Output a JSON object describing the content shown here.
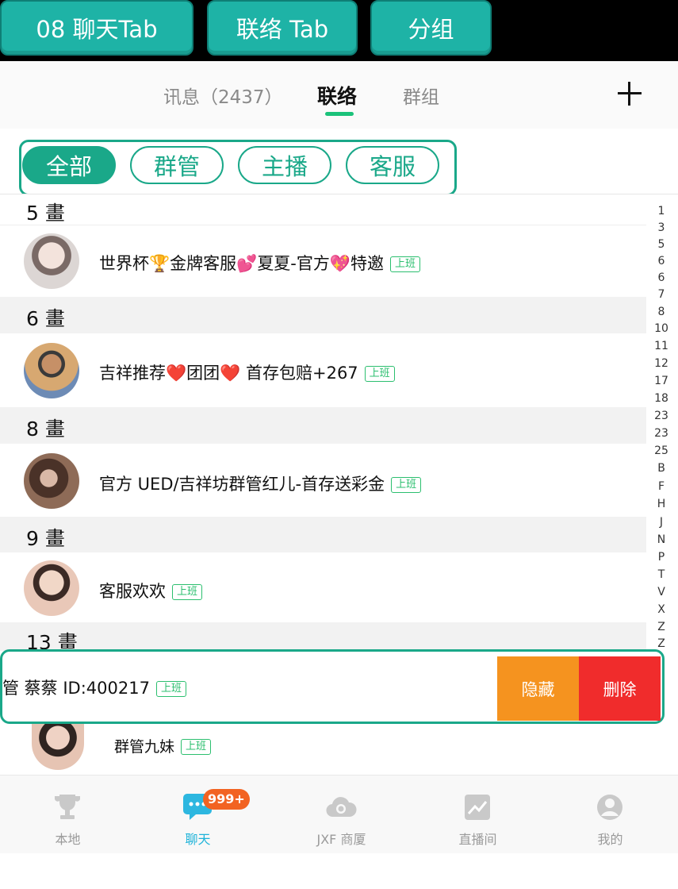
{
  "annotation_tabs": [
    "08 聊天Tab",
    "联络 Tab",
    "分组"
  ],
  "top_tabs": [
    {
      "label": "讯息（2437）",
      "active": false
    },
    {
      "label": "联络",
      "active": true
    },
    {
      "label": "群组",
      "active": false
    }
  ],
  "filters": [
    {
      "label": "全部",
      "active": true
    },
    {
      "label": "群管",
      "active": false
    },
    {
      "label": "主播",
      "active": false
    },
    {
      "label": "客服",
      "active": false
    }
  ],
  "sections": [
    {
      "header": "5 畫",
      "contact": {
        "name": "世界杯",
        "parts": [
          "🏆",
          "金牌客服",
          "💕",
          "夏夏-官方",
          "💖",
          "特邀"
        ],
        "status": "上班"
      }
    },
    {
      "header": "6 畫",
      "contact": {
        "name": "吉祥推荐",
        "parts": [
          "❤️",
          "团团",
          "❤️",
          " 首存包赔+267"
        ],
        "status": "上班"
      }
    },
    {
      "header": "8 畫",
      "contact": {
        "name": "官方 UED/吉祥坊群管红儿-首存送彩金",
        "parts": [],
        "status": "上班"
      }
    },
    {
      "header": "9 畫",
      "contact": {
        "name": "客服欢欢",
        "parts": [],
        "status": "上班"
      }
    },
    {
      "header": "13 畫"
    }
  ],
  "swipe_row": {
    "name": "管 蔡蔡 ID:400217",
    "status": "上班",
    "hide_label": "隐藏",
    "delete_label": "删除"
  },
  "last_contact": {
    "name": "群管九妹",
    "status": "上班"
  },
  "index_letters": [
    "1",
    "3",
    "5",
    "6",
    "6",
    "7",
    "8",
    "10",
    "11",
    "12",
    "17",
    "18",
    "23",
    "23",
    "25",
    "B",
    "F",
    "H",
    "J",
    "N",
    "P",
    "T",
    "V",
    "X",
    "Z",
    "Z"
  ],
  "bottom_tabs": [
    {
      "label": "本地",
      "icon": "trophy-icon"
    },
    {
      "label": "聊天",
      "icon": "chat-icon",
      "badge": "999+"
    },
    {
      "label": "JXF 商厦",
      "icon": "cloud-icon"
    },
    {
      "label": "直播间",
      "icon": "live-icon"
    },
    {
      "label": "我的",
      "icon": "user-icon"
    }
  ],
  "colors": {
    "accent": "#1aa889",
    "tab_active": "#1eb3d9",
    "hide": "#f5931f",
    "delete": "#f02c2c"
  }
}
